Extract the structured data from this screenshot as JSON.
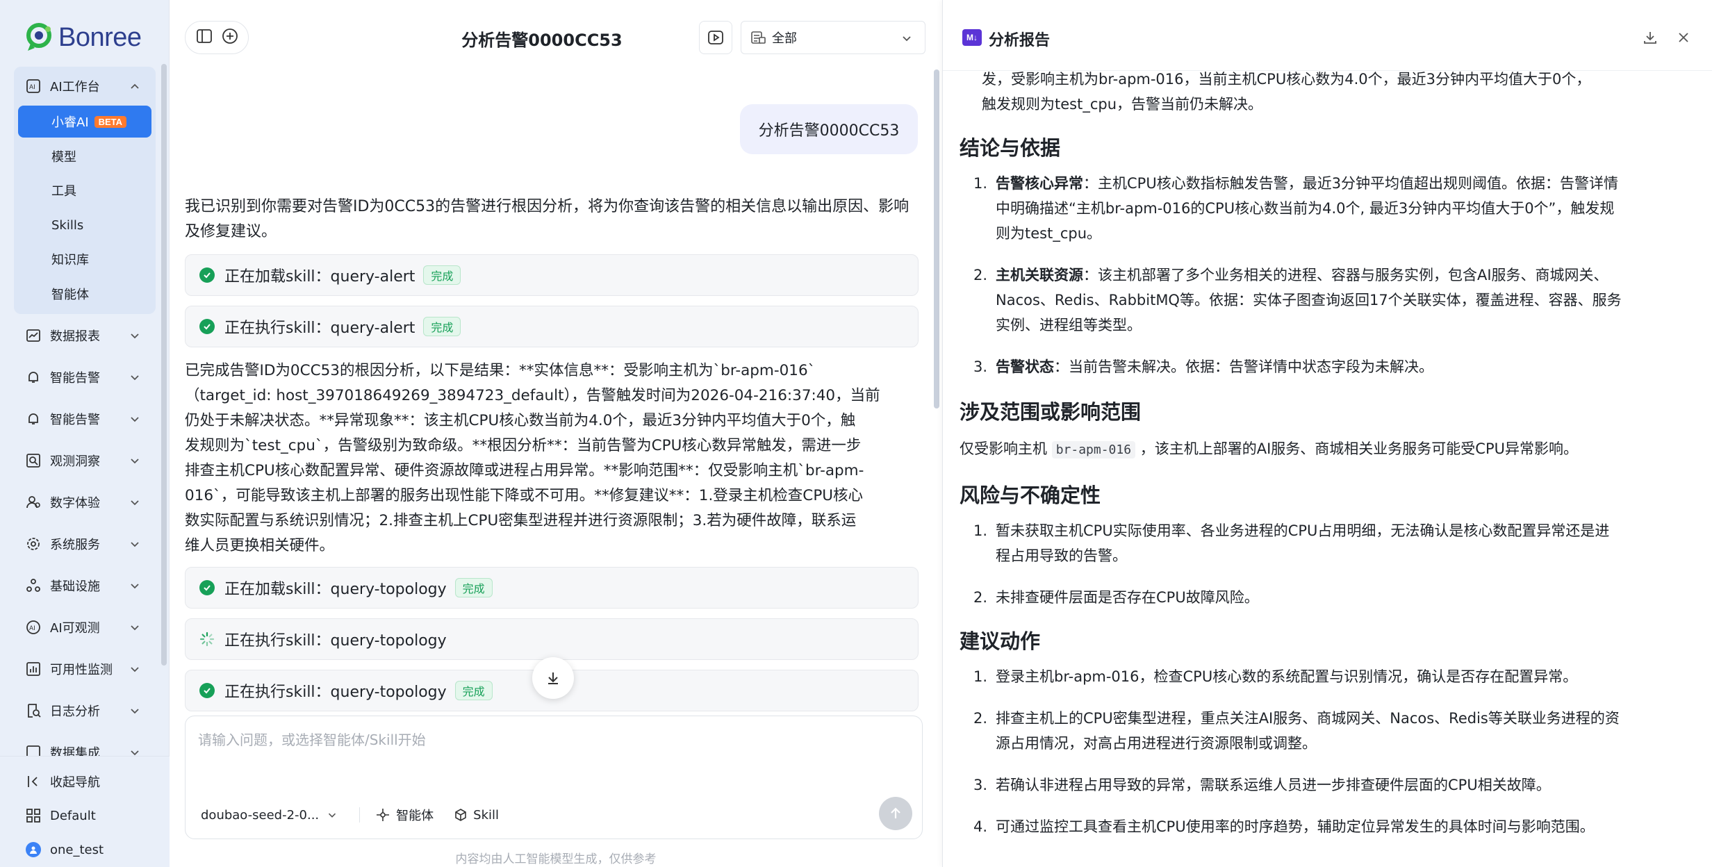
{
  "brand": {
    "logo_text": "Bonree"
  },
  "sidebar": {
    "group": {
      "label": "AI工作台",
      "items": [
        {
          "label": "小睿AI",
          "badge": "BETA"
        },
        {
          "label": "模型"
        },
        {
          "label": "工具"
        },
        {
          "label": "Skills"
        },
        {
          "label": "知识库"
        },
        {
          "label": "智能体"
        }
      ]
    },
    "items": [
      {
        "label": "数据报表"
      },
      {
        "label": "智能告警"
      },
      {
        "label": "智能告警"
      },
      {
        "label": "观测洞察"
      },
      {
        "label": "数字体验"
      },
      {
        "label": "系统服务"
      },
      {
        "label": "基础设施"
      },
      {
        "label": "AI可观测"
      },
      {
        "label": "可用性监测"
      },
      {
        "label": "日志分析"
      },
      {
        "label": "数据集成"
      }
    ],
    "bottom": {
      "collapse": "收起导航",
      "workspace": "Default",
      "user": "one_test"
    }
  },
  "chat": {
    "title": "分析告警0000CC53",
    "filter_value": "全部",
    "user_message": "分析告警0000CC53",
    "intro": "我已识别到你需要对告警ID为0CC53的告警进行根因分析，将为你查询该告警的相关信息以输出原因、影响及修复建议。",
    "skills_top": [
      {
        "text": "正在加载skill：query-alert",
        "status": "完成"
      },
      {
        "text": "正在执行skill：query-alert",
        "status": "完成"
      }
    ],
    "result_lines": [
      "已完成告警ID为0CC53的根因分析，以下是结果：**实体信息**：受影响主机为`br-apm-016`",
      "（target_id: host_397018649269_3894723_default），告警触发时间为2026-04-216:37:40，当前",
      "仍处于未解决状态。**异常现象**：该主机CPU核心数当前为4.0个，最近3分钟内平均值大于0个，触",
      "发规则为`test_cpu`，告警级别为致命级。**根因分析**：当前告警为CPU核心数异常触发，需进一步",
      "排查主机CPU核心数配置异常、硬件资源故障或进程占用异常。**影响范围**：仅受影响主机`br-apm-",
      "016`，可能导致该主机上部署的服务出现性能下降或不可用。**修复建议**：1.登录主机检查CPU核心",
      "数实际配置与系统识别情况；2.排查主机上CPU密集型进程并进行资源限制；3.若为硬件故障，联系运",
      "维人员更换相关硬件。"
    ],
    "skills_bottom": [
      {
        "text": "正在加载skill：query-topology",
        "status": "完成"
      },
      {
        "text": "正在执行skill：query-topology",
        "status": ""
      },
      {
        "text": "正在执行skill：query-topology",
        "status": "完成"
      }
    ],
    "input_placeholder": "请输入问题，或选择智能体/Skill开始",
    "model": "doubao-seed-2-0...",
    "agent_label": "智能体",
    "skill_label": "Skill",
    "disclaimer": "内容均由人工智能模型生成，仅供参考"
  },
  "report": {
    "title": "分析报告",
    "top_lines": [
      "发，受影响主机为br-apm-016，当前主机CPU核心数为4.0个，最近3分钟内平均值大于0个，",
      "触发规则为test_cpu，告警当前仍未解决。"
    ],
    "sections": {
      "conclusion": {
        "heading": "结论与依据",
        "items": [
          {
            "num": "1.",
            "bold": "告警核心异常",
            "lines": [
              "：主机CPU核心数指标触发告警，最近3分钟平均值超出规则阈值。依据：告警详情",
              "中明确描述“主机br-apm-016的CPU核心数当前为4.0个, 最近3分钟内平均值大于0个”，触发规",
              "则为test_cpu。"
            ]
          },
          {
            "num": "2.",
            "bold": "主机关联资源",
            "lines": [
              "：该主机部署了多个业务相关的进程、容器与服务实例，包含AI服务、商城网关、",
              "Nacos、Redis、RabbitMQ等。依据：实体子图查询返回17个关联实体，覆盖进程、容器、服务",
              "实例、进程组等类型。"
            ]
          },
          {
            "num": "3.",
            "bold": "告警状态",
            "lines": [
              "：当前告警未解决。依据：告警详情中状态字段为未解决。"
            ]
          }
        ]
      },
      "scope": {
        "heading": "涉及范围或影响范围",
        "prefix": "仅受影响主机",
        "code": "br-apm-016",
        "suffix": "，该主机上部署的AI服务、商城相关业务服务可能受CPU异常影响。"
      },
      "risk": {
        "heading": "风险与不确定性",
        "items": [
          {
            "num": "1.",
            "lines": [
              "暂未获取主机CPU实际使用率、各业务进程的CPU占用明细，无法确认是核心数配置异常还是进",
              "程占用导致的告警。"
            ]
          },
          {
            "num": "2.",
            "lines": [
              "未排查硬件层面是否存在CPU故障风险。"
            ]
          }
        ]
      },
      "actions": {
        "heading": "建议动作",
        "items": [
          {
            "num": "1.",
            "lines": [
              "登录主机br-apm-016，检查CPU核心数的系统配置与识别情况，确认是否存在配置异常。"
            ]
          },
          {
            "num": "2.",
            "lines": [
              "排查主机上的CPU密集型进程，重点关注AI服务、商城网关、Nacos、Redis等关联业务进程的资",
              "源占用情况，对高占用进程进行资源限制或调整。"
            ]
          },
          {
            "num": "3.",
            "lines": [
              "若确认非进程占用导致的异常，需联系运维人员进一步排查硬件层面的CPU相关故障。"
            ]
          },
          {
            "num": "4.",
            "lines": [
              "可通过监控工具查看主机CPU使用率的时序趋势，辅助定位异常发生的具体时间与影响范围。"
            ]
          }
        ]
      }
    }
  },
  "colors": {
    "primary": "#2f7af0",
    "success": "#17a058",
    "beta": "#ff7a2e",
    "markdown_icon": "#5b34d6"
  }
}
